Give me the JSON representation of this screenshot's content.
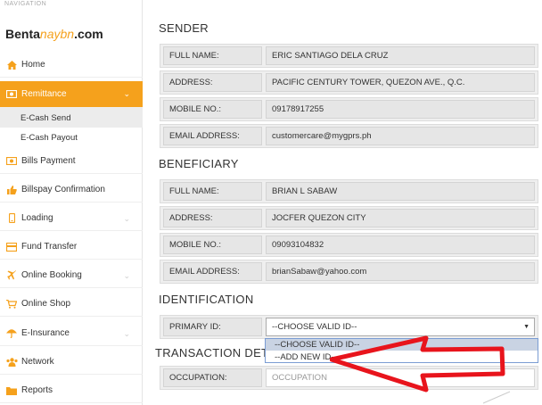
{
  "sidebar": {
    "caption": "NAVIGATION",
    "logo": {
      "part1": "Benta",
      "part2": "naybn",
      "part3": ".com"
    },
    "items": [
      {
        "label": "Home",
        "icon": "home-icon"
      },
      {
        "label": "Remittance",
        "icon": "money-icon"
      },
      {
        "label": "Bills Payment",
        "icon": "bill-icon"
      },
      {
        "label": "Billspay Confirmation",
        "icon": "thumbs-up-icon"
      },
      {
        "label": "Loading",
        "icon": "mobile-icon"
      },
      {
        "label": "Fund Transfer",
        "icon": "transfer-icon"
      },
      {
        "label": "Online Booking",
        "icon": "plane-icon"
      },
      {
        "label": "Online Shop",
        "icon": "cart-icon"
      },
      {
        "label": "E-Insurance",
        "icon": "umbrella-icon"
      },
      {
        "label": "Network",
        "icon": "users-icon"
      },
      {
        "label": "Reports",
        "icon": "folder-icon"
      }
    ],
    "sub_items": [
      {
        "label": "E-Cash Send"
      },
      {
        "label": "E-Cash Payout"
      }
    ],
    "accent_color": "#f5a11c"
  },
  "sender": {
    "title": "SENDER",
    "rows": [
      {
        "label": "FULL NAME:",
        "value": "ERIC SANTIAGO DELA CRUZ"
      },
      {
        "label": "ADDRESS:",
        "value": "PACIFIC CENTURY TOWER, QUEZON AVE., Q.C."
      },
      {
        "label": "MOBILE NO.:",
        "value": "09178917255"
      },
      {
        "label": "EMAIL ADDRESS:",
        "value": "customercare@mygprs.ph"
      }
    ]
  },
  "beneficiary": {
    "title": "BENEFICIARY",
    "rows": [
      {
        "label": "FULL NAME:",
        "value": "BRIAN L SABAW"
      },
      {
        "label": "ADDRESS:",
        "value": "JOCFER QUEZON CITY"
      },
      {
        "label": "MOBILE NO.:",
        "value": "09093104832"
      },
      {
        "label": "EMAIL ADDRESS:",
        "value": "brianSabaw@yahoo.com"
      }
    ]
  },
  "identification": {
    "title": "IDENTIFICATION",
    "primary_id_label": "PRIMARY ID:",
    "selected": "--CHOOSE VALID ID--",
    "options": [
      "--CHOOSE VALID ID--",
      "--ADD NEW ID--"
    ]
  },
  "transaction": {
    "title": "TRANSACTION DET",
    "occupation_label": "OCCUPATION:",
    "occupation_placeholder": "OCCUPATION"
  },
  "annotation_color": "#e8141c"
}
